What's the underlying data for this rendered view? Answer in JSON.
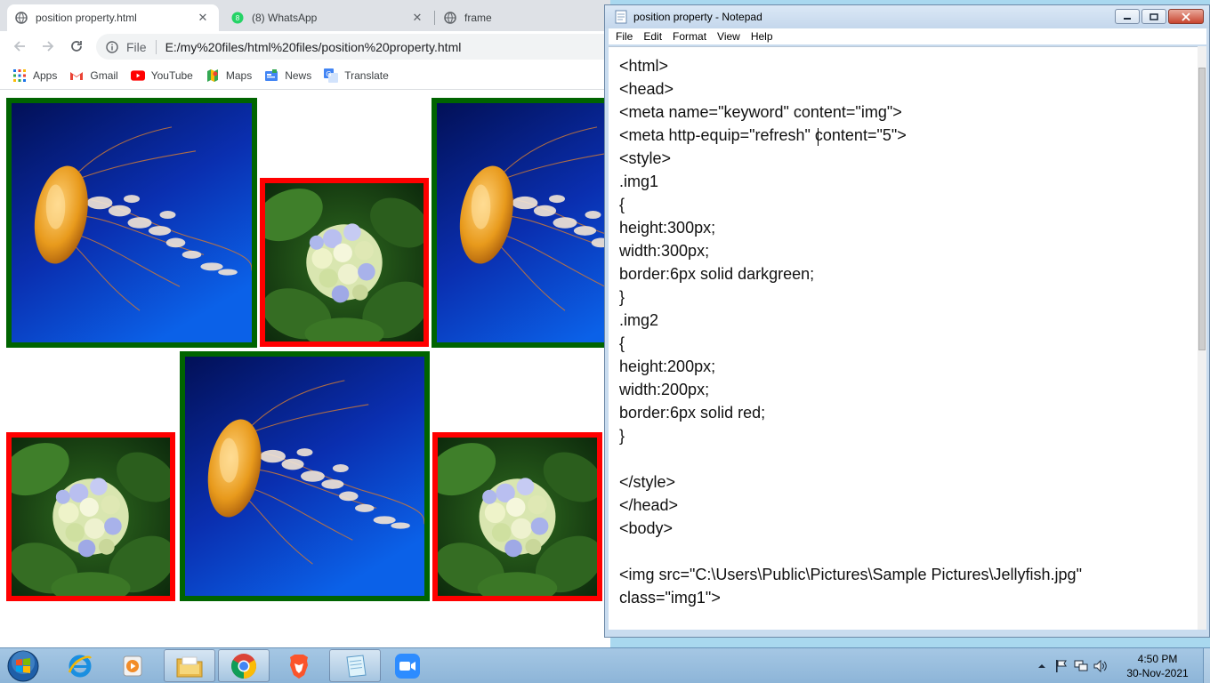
{
  "chrome": {
    "tabs": [
      {
        "label": "position property.html",
        "icon": "page-globe-icon",
        "close": "✕",
        "active": true
      },
      {
        "label": "(8) WhatsApp",
        "icon": "whatsapp-icon",
        "close": "✕",
        "active": false
      },
      {
        "label": "frame",
        "icon": "page-globe-icon",
        "active": false
      }
    ],
    "omnibox": {
      "scheme_label": "File",
      "url": "E:/my%20files/html%20files/position%20property.html"
    },
    "bookmarks": [
      {
        "label": "Apps",
        "icon": "apps-grid-icon"
      },
      {
        "label": "Gmail",
        "icon": "gmail-icon"
      },
      {
        "label": "YouTube",
        "icon": "youtube-icon"
      },
      {
        "label": "Maps",
        "icon": "maps-icon"
      },
      {
        "label": "News",
        "icon": "news-icon"
      },
      {
        "label": "Translate",
        "icon": "translate-icon"
      }
    ],
    "page_images": [
      {
        "kind": "jellyfish",
        "border_color": "#006400"
      },
      {
        "kind": "hydrangea",
        "border_color": "#ff0000"
      }
    ]
  },
  "notepad": {
    "title": "position property - Notepad",
    "menu": [
      "File",
      "Edit",
      "Format",
      "View",
      "Help"
    ],
    "lines": [
      "<html>",
      "<head>",
      "<meta name=\"keyword\" content=\"img\">",
      "<meta http-equip=\"refresh\" content=\"5\">",
      "<style>",
      ".img1",
      "{",
      "height:300px;",
      "width:300px;",
      "border:6px solid darkgreen;",
      "}",
      ".img2",
      "{",
      "height:200px;",
      "width:200px;",
      "border:6px solid red;",
      "}",
      "",
      "</style>",
      "</head>",
      "<body>",
      "",
      "<img src=\"C:\\Users\\Public\\Pictures\\Sample Pictures\\Jellyfish.jpg\"",
      "class=\"img1\">"
    ]
  },
  "taskbar": {
    "apps": [
      {
        "name": "internet-explorer",
        "icon": "ie-icon"
      },
      {
        "name": "media-player",
        "icon": "media-player-icon"
      },
      {
        "name": "file-explorer",
        "icon": "folder-icon"
      },
      {
        "name": "chrome",
        "icon": "chrome-icon"
      },
      {
        "name": "brave",
        "icon": "brave-icon"
      },
      {
        "name": "notepad",
        "icon": "notepad-icon"
      },
      {
        "name": "zoom",
        "icon": "zoom-icon"
      }
    ],
    "clock": {
      "time": "4:50 PM",
      "date": "30-Nov-2021"
    }
  },
  "colors": {
    "jelly_border": "#006400",
    "flower_border": "#ff0000",
    "taskbar": "#9fc3e2",
    "tab_strip": "#dee1e6"
  }
}
